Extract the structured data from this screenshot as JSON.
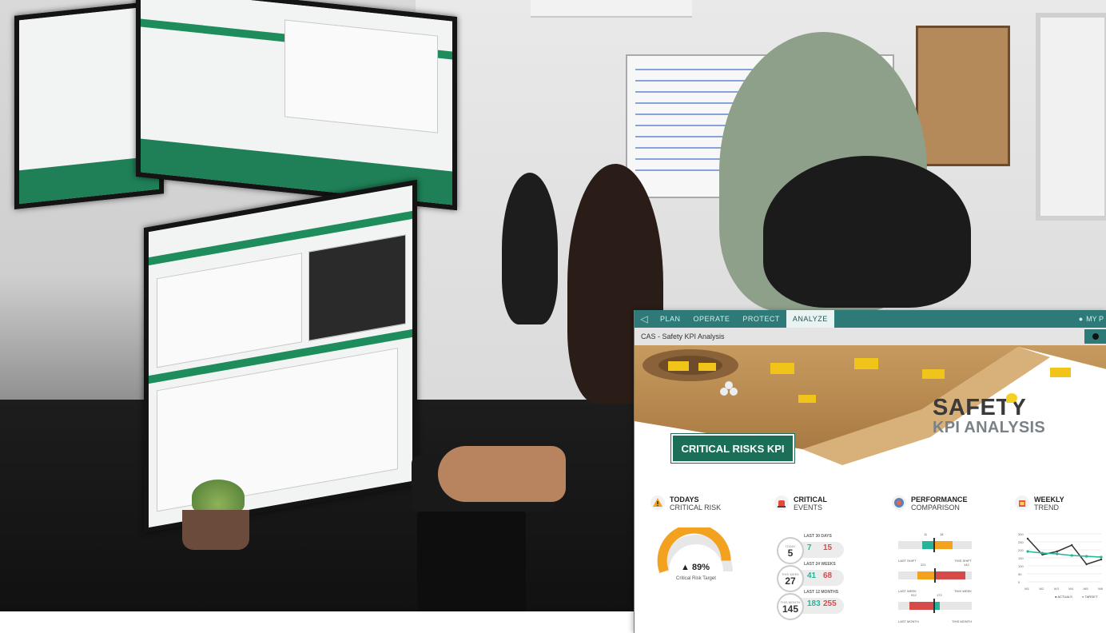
{
  "photo": {
    "alt_scene": "control room"
  },
  "dashboard": {
    "nav": {
      "items": [
        "PLAN",
        "OPERATE",
        "PROTECT",
        "ANALYZE"
      ],
      "active": "ANALYZE",
      "user_label": "MY P"
    },
    "subbar": {
      "title": "CAS - Safety KPI Analysis"
    },
    "hero": {
      "title": "SAFETY",
      "subtitle": "KPI ANALYSIS"
    },
    "banner": "CRITICAL RISKS KPI",
    "cards": {
      "todays": {
        "line1": "TODAYS",
        "line2": "CRITICAL RISK",
        "value": "89%",
        "label": "Critical Risk Target",
        "fill_fraction": 0.89
      },
      "events": {
        "line1": "CRITICAL",
        "line2": "EVENTS",
        "rows": [
          {
            "circle_small": "TODAY",
            "circle_num": "5",
            "caption": "LAST 30 DAYS",
            "best": "7",
            "worst": "15"
          },
          {
            "circle_small": "THIS WEEK",
            "circle_num": "27",
            "caption": "LAST 24 WEEKS",
            "best": "41",
            "worst": "68"
          },
          {
            "circle_small": "THIS MONTH",
            "circle_num": "145",
            "caption": "LAST 12 MONTHS",
            "best": "183",
            "worst": "255"
          }
        ]
      },
      "performance": {
        "line1": "PERFORMANCE",
        "line2": "COMPARISON",
        "rows": [
          {
            "left_label": "LAST SHIFT",
            "right_label": "THIS SHIFT",
            "n1": "11",
            "n2": "18"
          },
          {
            "left_label": "LAST WEEK",
            "right_label": "THIS WEEK",
            "n1": "221",
            "n2": "142"
          },
          {
            "left_label": "LAST MONTH",
            "right_label": "THIS MONTH",
            "n1": "912",
            "n2": "172"
          }
        ]
      },
      "weekly": {
        "line1": "WEEKLY",
        "line2": "TREND",
        "legend_actuals": "ACTUALS",
        "legend_target": "TARGET",
        "x_ticks": [
          "W1",
          "W2",
          "W3",
          "W4",
          "W5",
          "W6"
        ],
        "y_ticks": [
          "300",
          "250",
          "200",
          "150",
          "100",
          "50",
          "0"
        ]
      }
    }
  },
  "chart_data": {
    "type": "line",
    "x": [
      "W1",
      "W2",
      "W3",
      "W4",
      "W5",
      "W6"
    ],
    "series": [
      {
        "name": "ACTUALS",
        "values": [
          270,
          170,
          190,
          230,
          110,
          140
        ],
        "color": "#333333"
      },
      {
        "name": "TARGET",
        "values": [
          190,
          180,
          175,
          165,
          160,
          155
        ],
        "color": "#26b39a"
      }
    ],
    "ylim": [
      0,
      300
    ]
  },
  "colors": {
    "nav": "#2e7a78",
    "banner": "#1b6f58",
    "best": "#26b39a",
    "worst": "#d64a4a",
    "gauge": "#f2a21f"
  }
}
